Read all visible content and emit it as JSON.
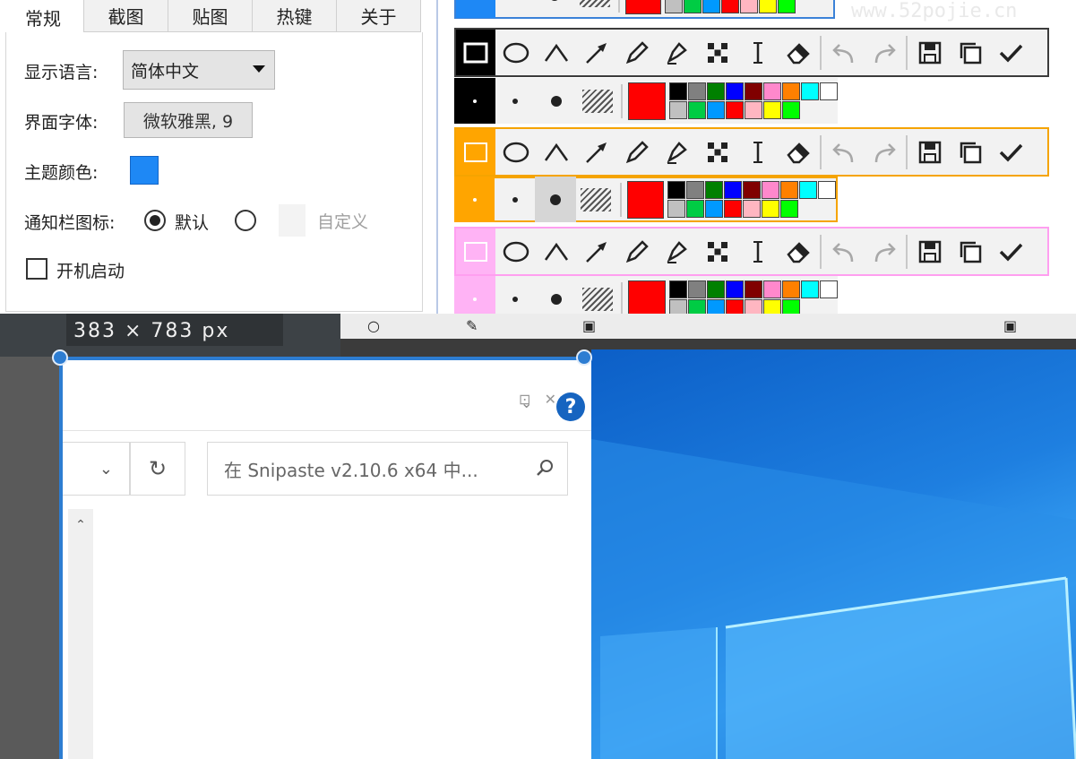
{
  "tabs": [
    "常规",
    "截图",
    "贴图",
    "热键",
    "关于"
  ],
  "general": {
    "language_label": "显示语言:",
    "language_value": "简体中文",
    "font_label": "界面字体:",
    "font_value": "微软雅黑, 9",
    "theme_label": "主题颜色:",
    "theme_color": "#1e88f5",
    "tray_label": "通知栏图标:",
    "tray_default": "默认",
    "tray_custom": "自定义",
    "startup_label": "开机启动"
  },
  "toolbar_previews": [
    {
      "border_color": "#000000",
      "accent": "#000000"
    },
    {
      "border_color": "#f5a400",
      "accent": "#ffa500"
    },
    {
      "border_color": "#ff9ff0",
      "accent": "#ffb3f5"
    }
  ],
  "palette_colors": [
    "#000000",
    "#808080",
    "#008000",
    "#0000ff",
    "#800000",
    "#ff88cc",
    "#ff8000",
    "#00ffff",
    "#ffffff",
    "#c0c0c0",
    "#00cc44",
    "#0099ff",
    "#ff0000",
    "#ffb6c1",
    "#ffff00",
    "#00ff00"
  ],
  "current_color": "#ff0000",
  "watermark": "www.52pojie.cn",
  "capture": {
    "size_readout": "383 × 783  px",
    "search_placeholder": "在 Snipaste v2.10.6 x64 中...",
    "help": "?"
  }
}
